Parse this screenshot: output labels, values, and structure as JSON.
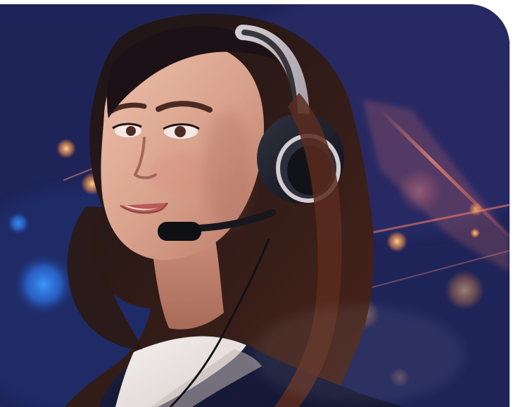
{
  "image": {
    "subject": "customer-support-agent-with-headset",
    "accent_colors": {
      "background": "#1f245b",
      "background_dark": "#171a3d",
      "light_streak": "#ff7b62",
      "bokeh_blue": "#2d7dff",
      "bokeh_warm": "#ffb15a",
      "hair": "#2b1a16",
      "skin": "#d5a08c",
      "headset": "#1a1c22",
      "headset_band": "#c6bdc1",
      "shirt": "#e7e1df",
      "jacket": "#1a1f3b"
    }
  }
}
